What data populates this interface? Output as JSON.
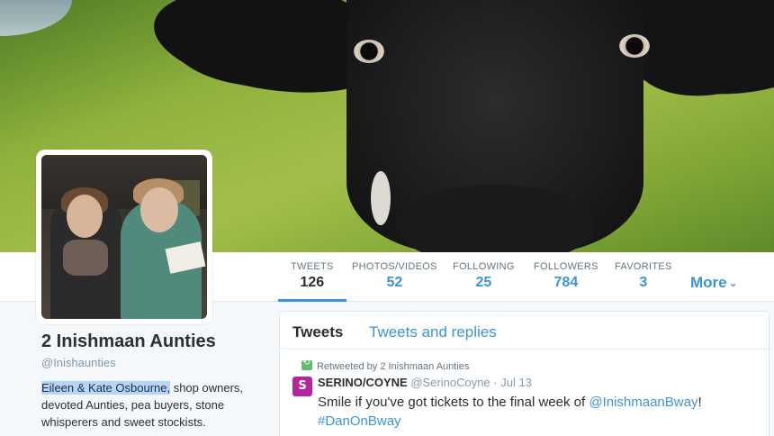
{
  "profile": {
    "name": "2 Inishmaan Aunties",
    "handle": "@Inishaunties",
    "bio_highlight": "Eileen & Kate Osbourne,",
    "bio_rest": " shop owners, devoted Aunties, pea buyers, stone whisperers and sweet stockists."
  },
  "nav": {
    "stats": [
      {
        "label": "TWEETS",
        "value": "126"
      },
      {
        "label": "PHOTOS/VIDEOS",
        "value": "52"
      },
      {
        "label": "FOLLOWING",
        "value": "25"
      },
      {
        "label": "FOLLOWERS",
        "value": "784"
      },
      {
        "label": "FAVORITES",
        "value": "3"
      }
    ],
    "more_label": "More",
    "more_icon": "chevron-down-icon"
  },
  "tabs": {
    "active": "Tweets",
    "other": "Tweets and replies"
  },
  "tweet": {
    "retweet_notice": "Retweeted by 2 Inishmaan Aunties",
    "avatar_letter": "S",
    "fullname": "SERINO/COYNE",
    "username": "@SerinoCoyne",
    "separator": " · ",
    "time": "Jul 13",
    "text_before": "Smile if you've got tickets to the final week of ",
    "mention": "@InishmaanBway",
    "text_after": "!",
    "hashtag": "#DanOnBway"
  },
  "colors": {
    "accent": "#3b94d9",
    "retweet": "#5fbb6d",
    "tweet_avatar": "#b4269b"
  }
}
